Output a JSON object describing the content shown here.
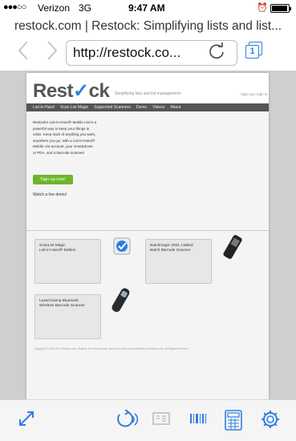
{
  "status_bar": {
    "signal": "●●●○○",
    "carrier": "Verizon",
    "network": "3G",
    "time": "9:47 AM"
  },
  "browser": {
    "page_title": "restock.com | Restock: Simplifying lists and list...",
    "url": "http://restock.co...",
    "tabs_count": "1"
  },
  "site": {
    "logo_text": "Rest",
    "logo_check": "✓",
    "logo_tail": "ck",
    "tagline": "Simplifying lists and list management",
    "account_links": "Sign Up | Sign In",
    "nav": [
      "List-in-Hand",
      "Scan List Magic",
      "Supported Scanners",
      "Demo",
      "Videos",
      "About"
    ],
    "intro": "Restock's List-in-Hand® Mobile List is a powerful way to keep your things in order. Keep track of anything you want, anywhere you go, with a List-in-Hand® Mobile List account, your smartphone or PDA, and a barcode scanner!",
    "signup_button": "Sign up now!",
    "demo_link": "Watch a live demo!",
    "products": [
      {
        "name": "ScanList Magic\nList-in-Hand® Edition"
      },
      {
        "name": "Batchmagic 2001 Cabled\nBatch Barcode Scanner"
      },
      {
        "name": "LaserChamp Bluetooth\nWireless Barcode Scanner"
      }
    ],
    "footer": "Copyright © 2008-2011 Restock.com. Restock, the Restock logo, and List-in-Hand are trademarks of Restock.com. All Rights Reserved."
  },
  "colors": {
    "ios_blue": "#2f7ee0",
    "site_green": "#6cb52c",
    "site_nav_bg": "#555555"
  },
  "icons": {
    "back": "chevron-left-icon",
    "forward": "chevron-right-icon",
    "reload": "reload-icon",
    "tabs": "tabs-icon",
    "fullscreen": "expand-arrows-icon",
    "speech": "speaker-icon",
    "reader": "reader-icon",
    "barcode": "barcode-icon",
    "calculator": "calculator-icon",
    "settings": "gear-icon"
  }
}
